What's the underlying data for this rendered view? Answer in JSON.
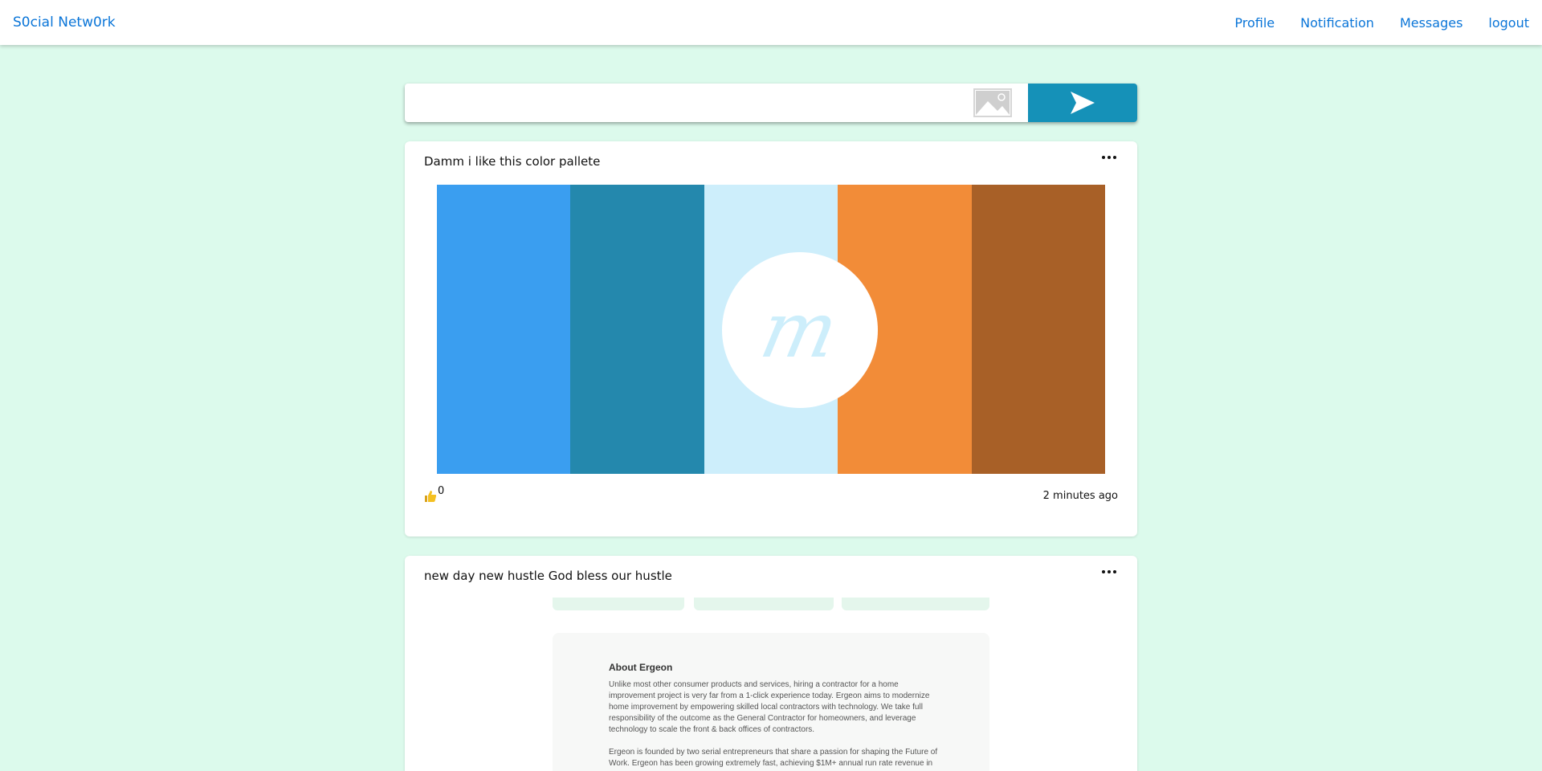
{
  "navbar": {
    "brand": "S0cial Netw0rk",
    "links": [
      "Profile",
      "Notification",
      "Messages",
      "logout"
    ]
  },
  "composer": {
    "placeholder": "",
    "image_icon": "image-icon",
    "send_icon": "send-arrow-icon",
    "send_color": "#1591b8"
  },
  "posts": [
    {
      "text": "Damm i like this color pallete",
      "image": {
        "palette_colors": [
          "#3a9ef0",
          "#2488ad",
          "#cdeefb",
          "#f28c38",
          "#a86027"
        ],
        "logo_letter": "m"
      },
      "likes": "0",
      "time": "2 minutes ago"
    },
    {
      "text": "new day new hustle God bless our hustle",
      "image": {
        "heading": "About Ergeon",
        "paragraph1": "Unlike most other consumer products and services, hiring a contractor for a home improvement project is very far from a 1-click experience today.  Ergeon aims to modernize home improvement by empowering skilled local contractors with technology. We take full responsibility of the outcome as the General Contractor for homeowners, and leverage technology to scale the front & back offices of contractors.",
        "paragraph2": "Ergeon is founded by two serial entrepreneurs that share a passion for shaping the Future of Work.  Ergeon has been growing extremely fast, achieving $1M+ annual run rate revenue in"
      }
    }
  ],
  "colors": {
    "background": "#dcfaec",
    "link": "#0a75d8"
  }
}
